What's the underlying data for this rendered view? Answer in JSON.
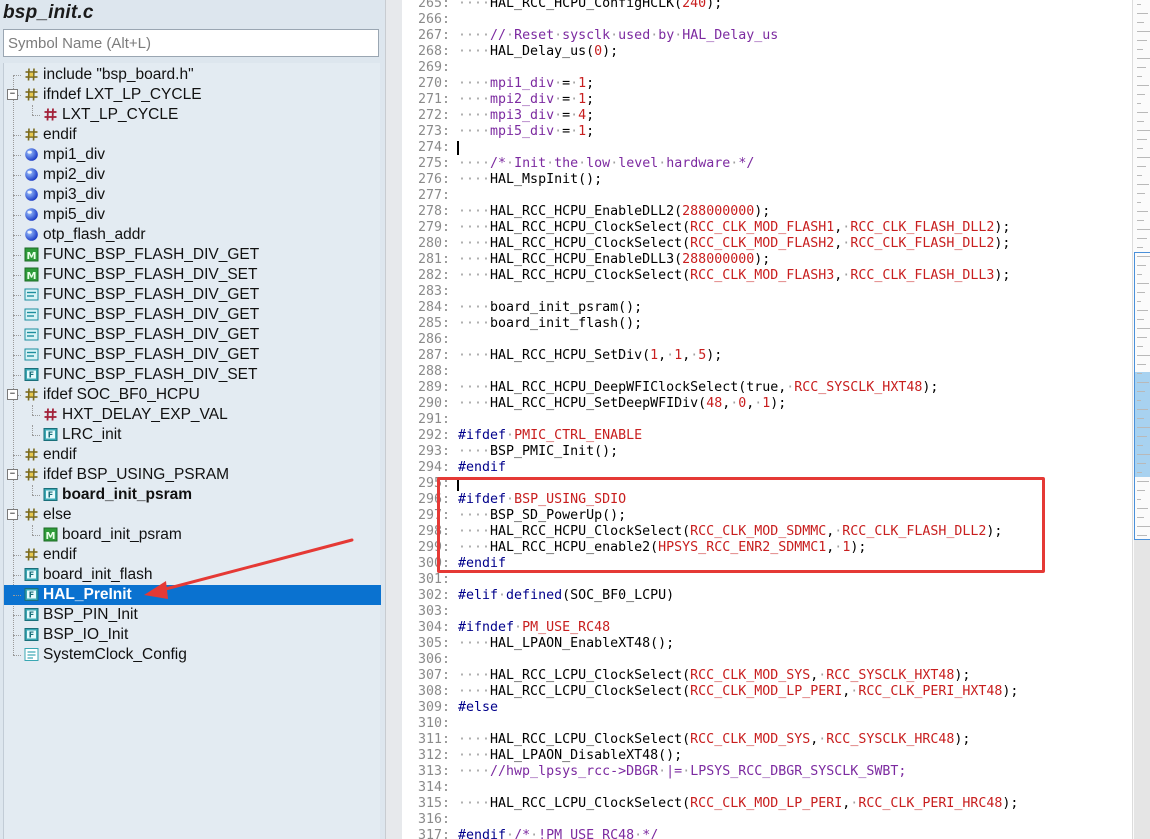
{
  "file_title": "bsp_init.c",
  "search": {
    "placeholder": "Symbol Name (Alt+L)",
    "value": ""
  },
  "tree": [
    {
      "label": "include \"bsp_board.h\"",
      "icon": "hash-icon",
      "depth": 0
    },
    {
      "label": "ifndef LXT_LP_CYCLE",
      "icon": "hash-icon",
      "depth": 0,
      "toggle": "-"
    },
    {
      "label": "LXT_LP_CYCLE",
      "icon": "define-icon",
      "depth": 1
    },
    {
      "label": "endif",
      "icon": "hash-icon",
      "depth": 0
    },
    {
      "label": "mpi1_div",
      "icon": "variable-icon",
      "depth": 0
    },
    {
      "label": "mpi2_div",
      "icon": "variable-icon",
      "depth": 0
    },
    {
      "label": "mpi3_div",
      "icon": "variable-icon",
      "depth": 0
    },
    {
      "label": "mpi5_div",
      "icon": "variable-icon",
      "depth": 0
    },
    {
      "label": "otp_flash_addr",
      "icon": "variable-icon",
      "depth": 0
    },
    {
      "label": "FUNC_BSP_FLASH_DIV_GET",
      "icon": "macro-icon",
      "depth": 0
    },
    {
      "label": "FUNC_BSP_FLASH_DIV_SET",
      "icon": "macro-icon",
      "depth": 0
    },
    {
      "label": "FUNC_BSP_FLASH_DIV_GET",
      "icon": "function-prototype-icon",
      "depth": 0
    },
    {
      "label": "FUNC_BSP_FLASH_DIV_GET",
      "icon": "function-prototype-icon",
      "depth": 0
    },
    {
      "label": "FUNC_BSP_FLASH_DIV_GET",
      "icon": "function-prototype-icon",
      "depth": 0
    },
    {
      "label": "FUNC_BSP_FLASH_DIV_GET",
      "icon": "function-prototype-icon",
      "depth": 0
    },
    {
      "label": "FUNC_BSP_FLASH_DIV_SET",
      "icon": "function-icon",
      "depth": 0
    },
    {
      "label": "ifdef SOC_BF0_HCPU",
      "icon": "hash-icon",
      "depth": 0,
      "toggle": "-"
    },
    {
      "label": "HXT_DELAY_EXP_VAL",
      "icon": "define-icon",
      "depth": 1
    },
    {
      "label": "LRC_init",
      "icon": "function-icon",
      "depth": 1
    },
    {
      "label": "endif",
      "icon": "hash-icon",
      "depth": 0
    },
    {
      "label": "ifdef BSP_USING_PSRAM",
      "icon": "hash-icon",
      "depth": 0,
      "toggle": "-"
    },
    {
      "label": "board_init_psram",
      "icon": "function-icon",
      "depth": 1,
      "bold": true
    },
    {
      "label": "else",
      "icon": "hash-icon",
      "depth": 0,
      "toggle": "-"
    },
    {
      "label": "board_init_psram",
      "icon": "macro-icon",
      "depth": 1
    },
    {
      "label": "endif",
      "icon": "hash-icon",
      "depth": 0
    },
    {
      "label": "board_init_flash",
      "icon": "function-icon",
      "depth": 0
    },
    {
      "label": "HAL_PreInit",
      "icon": "function-icon",
      "depth": 0,
      "selected": true
    },
    {
      "label": "BSP_PIN_Init",
      "icon": "function-icon",
      "depth": 0
    },
    {
      "label": "BSP_IO_Init",
      "icon": "function-icon",
      "depth": 0
    },
    {
      "label": "SystemClock_Config",
      "icon": "function-outline-icon",
      "depth": 0
    }
  ],
  "code": [
    {
      "n": "265:",
      "t": [
        [
          "dot",
          "····"
        ],
        [
          "fn",
          "HAL_RCC_HCPU_ConfigHCLK("
        ],
        [
          "num",
          "240"
        ],
        [
          "plain",
          ");"
        ]
      ]
    },
    {
      "n": "266:",
      "t": []
    },
    {
      "n": "267:",
      "t": [
        [
          "dot",
          "····"
        ],
        [
          "cm",
          "//"
        ],
        [
          "dot",
          "·"
        ],
        [
          "cm",
          "Reset"
        ],
        [
          "dot",
          "·"
        ],
        [
          "cm",
          "sysclk"
        ],
        [
          "dot",
          "·"
        ],
        [
          "cm",
          "used"
        ],
        [
          "dot",
          "·"
        ],
        [
          "cm",
          "by"
        ],
        [
          "dot",
          "·"
        ],
        [
          "cm",
          "HAL_Delay_us"
        ]
      ]
    },
    {
      "n": "268:",
      "t": [
        [
          "dot",
          "····"
        ],
        [
          "fn",
          "HAL_Delay_us("
        ],
        [
          "num",
          "0"
        ],
        [
          "plain",
          ");"
        ]
      ]
    },
    {
      "n": "269:",
      "t": []
    },
    {
      "n": "270:",
      "t": [
        [
          "dot",
          "····"
        ],
        [
          "cm",
          "mpi1_div"
        ],
        [
          "dot",
          "·"
        ],
        [
          "plain",
          "="
        ],
        [
          "dot",
          "·"
        ],
        [
          "num",
          "1"
        ],
        [
          "plain",
          ";"
        ]
      ]
    },
    {
      "n": "271:",
      "t": [
        [
          "dot",
          "····"
        ],
        [
          "cm",
          "mpi2_div"
        ],
        [
          "dot",
          "·"
        ],
        [
          "plain",
          "="
        ],
        [
          "dot",
          "·"
        ],
        [
          "num",
          "1"
        ],
        [
          "plain",
          ";"
        ]
      ]
    },
    {
      "n": "272:",
      "t": [
        [
          "dot",
          "····"
        ],
        [
          "cm",
          "mpi3_div"
        ],
        [
          "dot",
          "·"
        ],
        [
          "plain",
          "="
        ],
        [
          "dot",
          "·"
        ],
        [
          "num",
          "4"
        ],
        [
          "plain",
          ";"
        ]
      ]
    },
    {
      "n": "273:",
      "t": [
        [
          "dot",
          "····"
        ],
        [
          "cm",
          "mpi5_div"
        ],
        [
          "dot",
          "·"
        ],
        [
          "plain",
          "="
        ],
        [
          "dot",
          "·"
        ],
        [
          "num",
          "1"
        ],
        [
          "plain",
          ";"
        ]
      ]
    },
    {
      "n": "274:",
      "t": []
    },
    {
      "n": "275:",
      "t": [
        [
          "dot",
          "····"
        ],
        [
          "cm",
          "/*"
        ],
        [
          "dot",
          "·"
        ],
        [
          "cm",
          "Init"
        ],
        [
          "dot",
          "·"
        ],
        [
          "cm",
          "the"
        ],
        [
          "dot",
          "·"
        ],
        [
          "cm",
          "low"
        ],
        [
          "dot",
          "·"
        ],
        [
          "cm",
          "level"
        ],
        [
          "dot",
          "·"
        ],
        [
          "cm",
          "hardware"
        ],
        [
          "dot",
          "·"
        ],
        [
          "cm",
          "*/"
        ]
      ]
    },
    {
      "n": "276:",
      "t": [
        [
          "dot",
          "····"
        ],
        [
          "fn",
          "HAL_MspInit();"
        ]
      ]
    },
    {
      "n": "277:",
      "t": []
    },
    {
      "n": "278:",
      "t": [
        [
          "dot",
          "····"
        ],
        [
          "fn",
          "HAL_RCC_HCPU_EnableDLL2("
        ],
        [
          "num",
          "288000000"
        ],
        [
          "plain",
          ");"
        ]
      ]
    },
    {
      "n": "279:",
      "t": [
        [
          "dot",
          "····"
        ],
        [
          "fn",
          "HAL_RCC_HCPU_ClockSelect("
        ],
        [
          "macro",
          "RCC_CLK_MOD_FLASH1"
        ],
        [
          "plain",
          ","
        ],
        [
          "dot",
          "·"
        ],
        [
          "macro",
          "RCC_CLK_FLASH_DLL2"
        ],
        [
          "plain",
          ");"
        ]
      ]
    },
    {
      "n": "280:",
      "t": [
        [
          "dot",
          "····"
        ],
        [
          "fn",
          "HAL_RCC_HCPU_ClockSelect("
        ],
        [
          "macro",
          "RCC_CLK_MOD_FLASH2"
        ],
        [
          "plain",
          ","
        ],
        [
          "dot",
          "·"
        ],
        [
          "macro",
          "RCC_CLK_FLASH_DLL2"
        ],
        [
          "plain",
          ");"
        ]
      ]
    },
    {
      "n": "281:",
      "t": [
        [
          "dot",
          "····"
        ],
        [
          "fn",
          "HAL_RCC_HCPU_EnableDLL3("
        ],
        [
          "num",
          "288000000"
        ],
        [
          "plain",
          ");"
        ]
      ]
    },
    {
      "n": "282:",
      "t": [
        [
          "dot",
          "····"
        ],
        [
          "fn",
          "HAL_RCC_HCPU_ClockSelect("
        ],
        [
          "macro",
          "RCC_CLK_MOD_FLASH3"
        ],
        [
          "plain",
          ","
        ],
        [
          "dot",
          "·"
        ],
        [
          "macro",
          "RCC_CLK_FLASH_DLL3"
        ],
        [
          "plain",
          ");"
        ]
      ]
    },
    {
      "n": "283:",
      "t": []
    },
    {
      "n": "284:",
      "t": [
        [
          "dot",
          "····"
        ],
        [
          "fn",
          "board_init_psram();"
        ]
      ]
    },
    {
      "n": "285:",
      "t": [
        [
          "dot",
          "····"
        ],
        [
          "fn",
          "board_init_flash();"
        ]
      ]
    },
    {
      "n": "286:",
      "t": []
    },
    {
      "n": "287:",
      "t": [
        [
          "dot",
          "····"
        ],
        [
          "fn",
          "HAL_RCC_HCPU_SetDiv("
        ],
        [
          "num",
          "1"
        ],
        [
          "plain",
          ","
        ],
        [
          "dot",
          "·"
        ],
        [
          "num",
          "1"
        ],
        [
          "plain",
          ","
        ],
        [
          "dot",
          "·"
        ],
        [
          "num",
          "5"
        ],
        [
          "plain",
          ");"
        ]
      ]
    },
    {
      "n": "288:",
      "t": []
    },
    {
      "n": "289:",
      "t": [
        [
          "dot",
          "····"
        ],
        [
          "fn",
          "HAL_RCC_HCPU_DeepWFIClockSelect(true,"
        ],
        [
          "dot",
          "·"
        ],
        [
          "macro",
          "RCC_SYSCLK_HXT48"
        ],
        [
          "plain",
          ");"
        ]
      ]
    },
    {
      "n": "290:",
      "t": [
        [
          "dot",
          "····"
        ],
        [
          "fn",
          "HAL_RCC_HCPU_SetDeepWFIDiv("
        ],
        [
          "num",
          "48"
        ],
        [
          "plain",
          ","
        ],
        [
          "dot",
          "·"
        ],
        [
          "num",
          "0"
        ],
        [
          "plain",
          ","
        ],
        [
          "dot",
          "·"
        ],
        [
          "num",
          "1"
        ],
        [
          "plain",
          ");"
        ]
      ]
    },
    {
      "n": "291:",
      "t": []
    },
    {
      "n": "292:",
      "t": [
        [
          "kw",
          "#ifdef"
        ],
        [
          "dot",
          "·"
        ],
        [
          "macro",
          "PMIC_CTRL_ENABLE"
        ]
      ]
    },
    {
      "n": "293:",
      "t": [
        [
          "dot",
          "····"
        ],
        [
          "fn",
          "BSP_PMIC_Init();"
        ]
      ]
    },
    {
      "n": "294:",
      "t": [
        [
          "kw",
          "#endif"
        ]
      ]
    },
    {
      "n": "295:",
      "t": []
    },
    {
      "n": "296:",
      "t": [
        [
          "kw",
          "#ifdef"
        ],
        [
          "dot",
          "·"
        ],
        [
          "macro",
          "BSP_USING_SDIO"
        ]
      ]
    },
    {
      "n": "297:",
      "t": [
        [
          "dot",
          "····"
        ],
        [
          "fn",
          "BSP_SD_PowerUp();"
        ]
      ]
    },
    {
      "n": "298:",
      "t": [
        [
          "dot",
          "····"
        ],
        [
          "fn",
          "HAL_RCC_HCPU_ClockSelect("
        ],
        [
          "macro",
          "RCC_CLK_MOD_SDMMC"
        ],
        [
          "plain",
          ","
        ],
        [
          "dot",
          "·"
        ],
        [
          "macro",
          "RCC_CLK_FLASH_DLL2"
        ],
        [
          "plain",
          ");"
        ]
      ]
    },
    {
      "n": "299:",
      "t": [
        [
          "dot",
          "····"
        ],
        [
          "fn",
          "HAL_RCC_HCPU_enable2("
        ],
        [
          "macro",
          "HPSYS_RCC_ENR2_SDMMC1"
        ],
        [
          "plain",
          ","
        ],
        [
          "dot",
          "·"
        ],
        [
          "num",
          "1"
        ],
        [
          "plain",
          ");"
        ]
      ]
    },
    {
      "n": "300:",
      "t": [
        [
          "kw",
          "#endif"
        ]
      ]
    },
    {
      "n": "301:",
      "t": []
    },
    {
      "n": "302:",
      "t": [
        [
          "kw",
          "#elif"
        ],
        [
          "dot",
          "·"
        ],
        [
          "kw",
          "defined"
        ],
        [
          "plain",
          "(SOC_BF0_LCPU)"
        ]
      ]
    },
    {
      "n": "303:",
      "t": []
    },
    {
      "n": "304:",
      "t": [
        [
          "kw",
          "#ifndef"
        ],
        [
          "dot",
          "·"
        ],
        [
          "macro",
          "PM_USE_RC48"
        ]
      ]
    },
    {
      "n": "305:",
      "t": [
        [
          "dot",
          "····"
        ],
        [
          "fn",
          "HAL_LPAON_EnableXT48();"
        ]
      ]
    },
    {
      "n": "306:",
      "t": []
    },
    {
      "n": "307:",
      "t": [
        [
          "dot",
          "····"
        ],
        [
          "fn",
          "HAL_RCC_LCPU_ClockSelect("
        ],
        [
          "macro",
          "RCC_CLK_MOD_SYS"
        ],
        [
          "plain",
          ","
        ],
        [
          "dot",
          "·"
        ],
        [
          "macro",
          "RCC_SYSCLK_HXT48"
        ],
        [
          "plain",
          ");"
        ]
      ]
    },
    {
      "n": "308:",
      "t": [
        [
          "dot",
          "····"
        ],
        [
          "fn",
          "HAL_RCC_LCPU_ClockSelect("
        ],
        [
          "macro",
          "RCC_CLK_MOD_LP_PERI"
        ],
        [
          "plain",
          ","
        ],
        [
          "dot",
          "·"
        ],
        [
          "macro",
          "RCC_CLK_PERI_HXT48"
        ],
        [
          "plain",
          ");"
        ]
      ]
    },
    {
      "n": "309:",
      "t": [
        [
          "kw",
          "#else"
        ]
      ]
    },
    {
      "n": "310:",
      "t": []
    },
    {
      "n": "311:",
      "t": [
        [
          "dot",
          "····"
        ],
        [
          "fn",
          "HAL_RCC_LCPU_ClockSelect("
        ],
        [
          "macro",
          "RCC_CLK_MOD_SYS"
        ],
        [
          "plain",
          ","
        ],
        [
          "dot",
          "·"
        ],
        [
          "macro",
          "RCC_SYSCLK_HRC48"
        ],
        [
          "plain",
          ");"
        ]
      ]
    },
    {
      "n": "312:",
      "t": [
        [
          "dot",
          "····"
        ],
        [
          "fn",
          "HAL_LPAON_DisableXT48();"
        ]
      ]
    },
    {
      "n": "313:",
      "t": [
        [
          "dot",
          "····"
        ],
        [
          "cm",
          "//hwp_lpsys_rcc->DBGR"
        ],
        [
          "dot",
          "·"
        ],
        [
          "cm",
          "|="
        ],
        [
          "dot",
          "·"
        ],
        [
          "cm",
          "LPSYS_RCC_DBGR_SYSCLK_SWBT;"
        ]
      ]
    },
    {
      "n": "314:",
      "t": []
    },
    {
      "n": "315:",
      "t": [
        [
          "dot",
          "····"
        ],
        [
          "fn",
          "HAL_RCC_LCPU_ClockSelect("
        ],
        [
          "macro",
          "RCC_CLK_MOD_LP_PERI"
        ],
        [
          "plain",
          ","
        ],
        [
          "dot",
          "·"
        ],
        [
          "macro",
          "RCC_CLK_PERI_HRC48"
        ],
        [
          "plain",
          ");"
        ]
      ]
    },
    {
      "n": "316:",
      "t": []
    },
    {
      "n": "317:",
      "t": [
        [
          "kw",
          "#endif"
        ],
        [
          "dot",
          "·"
        ],
        [
          "cm",
          "/*"
        ],
        [
          "dot",
          "·"
        ],
        [
          "cm",
          "!PM_USE_RC48"
        ],
        [
          "dot",
          "·"
        ],
        [
          "cm",
          "*/"
        ]
      ]
    }
  ],
  "colors": {
    "selection": "#0a72d0",
    "annotation": "#e53935"
  }
}
